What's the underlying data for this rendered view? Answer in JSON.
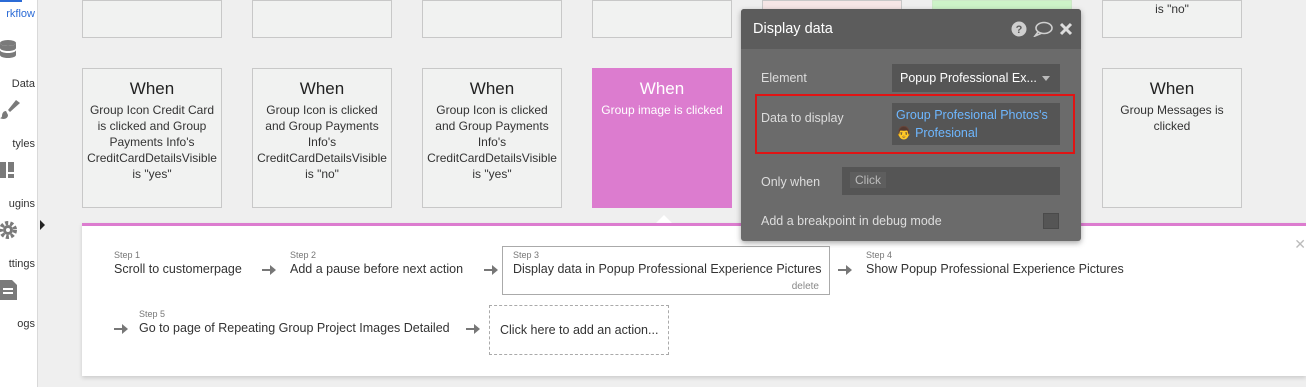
{
  "sidebar": {
    "items": [
      {
        "label": "rkflow",
        "icon": "workflow-icon"
      },
      {
        "label": "Data",
        "icon": "database-icon"
      },
      {
        "label": "tyles",
        "icon": "brush-icon"
      },
      {
        "label": "ugins",
        "icon": "plugins-icon"
      },
      {
        "label": "ttings",
        "icon": "gear-icon"
      },
      {
        "label": "ogs",
        "icon": "document-icon"
      }
    ]
  },
  "top_cards": [
    {
      "text": ""
    },
    {
      "text": ""
    },
    {
      "text": ""
    },
    {
      "text": ""
    },
    {
      "text": ""
    },
    {
      "text": ""
    },
    {
      "text": "is \"no\""
    }
  ],
  "event_cards": [
    {
      "when": "When",
      "condition": "Group Icon Credit Card is clicked and Group Payments Info's CreditCardDetailsVisible is \"yes\""
    },
    {
      "when": "When",
      "condition": "Group Icon is clicked and Group Payments Info's CreditCardDetailsVisible is \"no\""
    },
    {
      "when": "When",
      "condition": "Group Icon is clicked and Group Payments Info's CreditCardDetailsVisible is \"yes\""
    },
    {
      "when": "When",
      "condition": "Group image is clicked"
    },
    {
      "when": "When",
      "condition": "Group Messages is clicked"
    }
  ],
  "steps": [
    {
      "num": "Step 1",
      "title": "Scroll to customerpage"
    },
    {
      "num": "Step 2",
      "title": "Add a pause before next action"
    },
    {
      "num": "Step 3",
      "title": "Display data in Popup Professional Experience Pictures",
      "delete": "delete"
    },
    {
      "num": "Step 4",
      "title": "Show Popup Professional Experience Pictures"
    },
    {
      "num": "Step 5",
      "title": "Go to page of Repeating Group Project Images Detailed"
    }
  ],
  "add_action": "Click here to add an action...",
  "popup": {
    "title": "Display data",
    "element_label": "Element",
    "element_value": "Popup Professional Ex...",
    "data_label": "Data to display",
    "data_line1": "Group Profesional Photos's",
    "data_line2": "Profesional",
    "data_person_icon": "👨",
    "only_when_label": "Only when",
    "only_when_placeholder": "Click",
    "breakpoint_label": "Add a breakpoint in debug mode"
  },
  "colors": {
    "accent_pink": "#dc7ccf",
    "popup_bg": "#6b6b6b",
    "link_blue": "#6eb7ff",
    "highlight_red": "#e01414"
  }
}
